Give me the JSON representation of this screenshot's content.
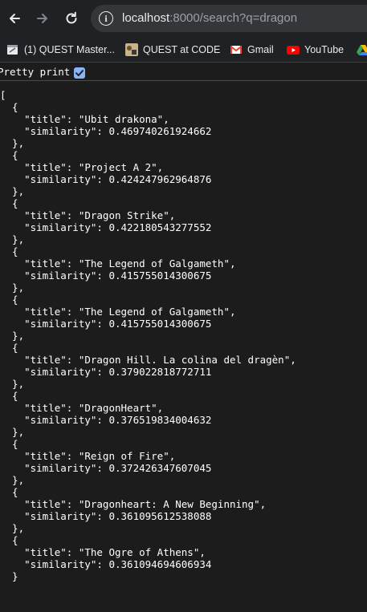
{
  "browser": {
    "url_host": "localhost",
    "url_rest": ":8000/search?q=dragon",
    "icons": {
      "back": "arrow-left-icon",
      "forward": "arrow-right-icon",
      "reload": "reload-icon",
      "info": "info-icon"
    }
  },
  "bookmarks": [
    {
      "label": "(1) QUEST Master...",
      "icon": "quest-master-favicon"
    },
    {
      "label": "QUEST at CODE",
      "icon": "quest-code-favicon"
    },
    {
      "label": "Gmail",
      "icon": "gmail-icon"
    },
    {
      "label": "YouTube",
      "icon": "youtube-icon"
    }
  ],
  "pretty_print": {
    "label": "Pretty print",
    "checked": true
  },
  "json_lines": [
    "[",
    "  {",
    "    \"title\": \"Ubit drakona\",",
    "    \"similarity\": 0.469740261924662",
    "  },",
    "  {",
    "    \"title\": \"Project A 2\",",
    "    \"similarity\": 0.424247962964876",
    "  },",
    "  {",
    "    \"title\": \"Dragon Strike\",",
    "    \"similarity\": 0.422180543277552",
    "  },",
    "  {",
    "    \"title\": \"The Legend of Galgameth\",",
    "    \"similarity\": 0.415755014300675",
    "  },",
    "  {",
    "    \"title\": \"The Legend of Galgameth\",",
    "    \"similarity\": 0.415755014300675",
    "  },",
    "  {",
    "    \"title\": \"Dragon Hill. La colina del dragèn\",",
    "    \"similarity\": 0.379022818772711",
    "  },",
    "  {",
    "    \"title\": \"DragonHeart\",",
    "    \"similarity\": 0.376519834004632",
    "  },",
    "  {",
    "    \"title\": \"Reign of Fire\",",
    "    \"similarity\": 0.372426347607045",
    "  },",
    "  {",
    "    \"title\": \"Dragonheart: A New Beginning\",",
    "    \"similarity\": 0.361095612538088",
    "  },",
    "  {",
    "    \"title\": \"The Ogre of Athens\",",
    "    \"similarity\": 0.361094694606934",
    "  }"
  ],
  "colors": {
    "toolbar": "#202124",
    "page_background": "#1c1c1c",
    "omnibox": "#35363a",
    "checkbox": "#8ab4f8",
    "youtube_red": "#ff0000",
    "gmail_red": "#ea4335"
  }
}
